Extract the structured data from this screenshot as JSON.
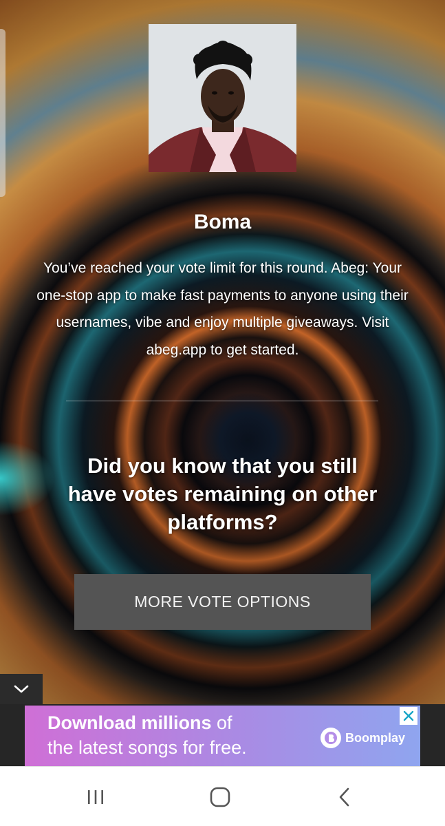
{
  "contestant": {
    "name": "Boma",
    "photo_alt": "Boma"
  },
  "message": "You’ve reached your vote limit for this round. Abeg: Your one-stop app to make fast payments to anyone using their usernames, vibe and enjoy multiple giveaways. Visit abeg.app to get started.",
  "prompt": {
    "question": "Did you know that you still have votes remaining on other platforms?",
    "button_label": "MORE VOTE OPTIONS"
  },
  "ad": {
    "line1_strong": "Download millions",
    "line1_rest": " of",
    "line2": "the latest songs for free.",
    "brand": "Boomplay"
  },
  "icons": {
    "collapse": "chevron-down-icon",
    "ad_close": "close-icon",
    "nav_recents": "recent-apps-icon",
    "nav_home": "home-icon",
    "nav_back": "back-icon"
  },
  "colors": {
    "button_bg": "#545454",
    "ad_gradient_start": "#cf6fd6",
    "ad_gradient_end": "#8fa5ef",
    "ad_close": "#1aa6c7"
  }
}
